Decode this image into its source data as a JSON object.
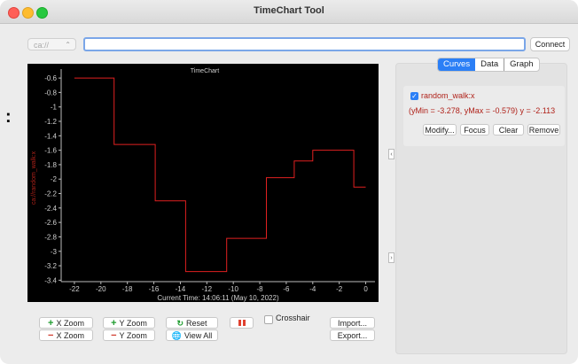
{
  "window": {
    "title": "TimeChart Tool"
  },
  "toolbar": {
    "protocol_value": "ca://",
    "pv_value": "",
    "connect_label": "Connect"
  },
  "tabs": [
    {
      "label": "Curves",
      "active": true
    },
    {
      "label": "Data",
      "active": false
    },
    {
      "label": "Graph",
      "active": false
    }
  ],
  "curve": {
    "checked": true,
    "name": "random_walk:x",
    "info": "(yMin = -3.278, yMax = -0.579) y = -2.113",
    "buttons": [
      "Modify...",
      "Focus",
      "Clear",
      "Remove"
    ],
    "color": "#b0221a"
  },
  "controls": {
    "x_zoom_in": "X Zoom",
    "x_zoom_out": "X Zoom",
    "y_zoom_in": "Y Zoom",
    "y_zoom_out": "Y Zoom",
    "reset": "Reset",
    "view_all": "View All",
    "crosshair": "Crosshair",
    "import": "Import...",
    "export": "Export..."
  },
  "chart_data": {
    "type": "line",
    "title": "TimeChart",
    "ylabel": "ca://random_walk:x",
    "xlabel": "Current Time: 14:06:11 (May 10, 2022)",
    "xlim": [
      -23,
      0.7
    ],
    "ylim": [
      -3.42,
      -0.55
    ],
    "xticks": [
      -22,
      -20,
      -18,
      -16,
      -14,
      -12,
      -10,
      -8,
      -6,
      -4,
      -2,
      0
    ],
    "yticks": [
      -0.6,
      -0.8,
      -1,
      -1.2,
      -1.4,
      -1.6,
      -1.8,
      -2,
      -2.2,
      -2.4,
      -2.6,
      -2.8,
      -3,
      -3.2,
      -3.4
    ],
    "ytick_labels": [
      "-0.6",
      "-0.8",
      "-1",
      "-1.2",
      "-1.4",
      "-1.6",
      "-1.8",
      "-2",
      "-2.2",
      "-2.4",
      "-2.6",
      "-2.8",
      "-3",
      "-3.2",
      "-3.4"
    ],
    "series": [
      {
        "color": "#e02020",
        "step_points": [
          [
            -22,
            -0.6
          ],
          [
            -19,
            -0.6
          ],
          [
            -19,
            -1.52
          ],
          [
            -15.9,
            -1.52
          ],
          [
            -15.9,
            -2.3
          ],
          [
            -13.6,
            -2.3
          ],
          [
            -13.6,
            -3.28
          ],
          [
            -10.5,
            -3.28
          ],
          [
            -10.5,
            -2.82
          ],
          [
            -7.5,
            -2.82
          ],
          [
            -7.5,
            -1.98
          ],
          [
            -5.4,
            -1.98
          ],
          [
            -5.4,
            -1.75
          ],
          [
            -4,
            -1.75
          ],
          [
            -4,
            -1.6
          ],
          [
            -0.9,
            -1.6
          ],
          [
            -0.9,
            -2.11
          ],
          [
            0,
            -2.11
          ]
        ]
      }
    ]
  }
}
